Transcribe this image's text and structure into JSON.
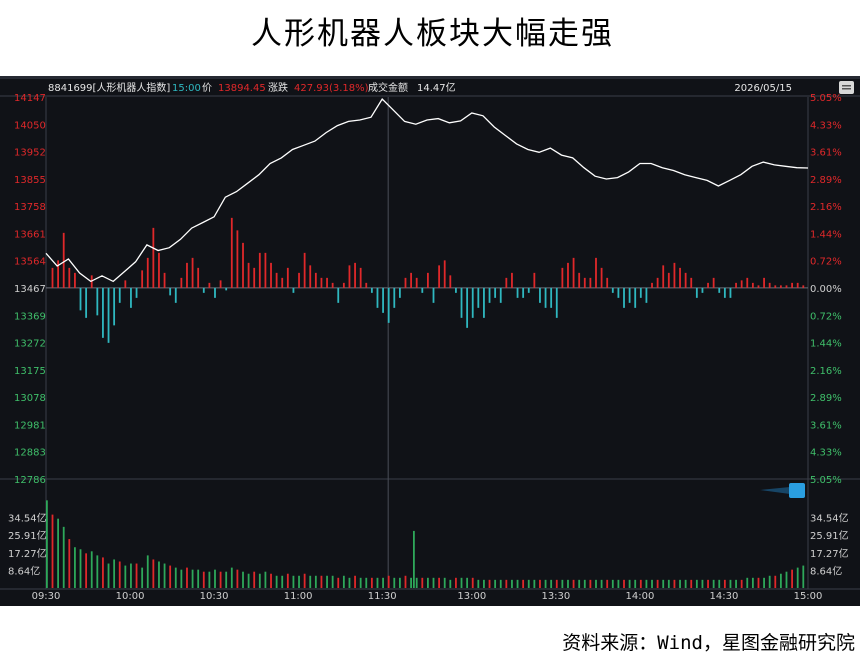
{
  "page": {
    "title": "人形机器人板块大幅走强",
    "source": "资料来源：Wind，星图金融研究院"
  },
  "info_bar": {
    "code": "8841699[人形机器人指数]",
    "time": "15:00",
    "price_label": "价",
    "price": "13894.45",
    "change_label": "涨跌",
    "change": "427.93(3.18%)",
    "turnover_label": "成交金额",
    "turnover": "14.47亿",
    "date": "2026/05/15"
  },
  "colors": {
    "up": "#e0282a",
    "down": "#2fb8c0",
    "price_line": "#ffffff",
    "panel_bg": "#101217",
    "axis_text_left": "#e0282a",
    "grid": "#2a2d35"
  },
  "chart_data": {
    "type": "line",
    "price_ticks": [
      "14147",
      "14050",
      "13952",
      "13855",
      "13758",
      "13661",
      "13564",
      "13467",
      "13369",
      "13272",
      "13175",
      "13078",
      "12981",
      "12883",
      "12786"
    ],
    "pct_ticks": [
      "5.05%",
      "4.33%",
      "3.61%",
      "2.89%",
      "2.16%",
      "1.44%",
      "0.72%",
      "0.00%",
      "0.72%",
      "1.44%",
      "2.16%",
      "2.89%",
      "3.61%",
      "4.33%",
      "5.05%"
    ],
    "volume_ticks": [
      "34.54亿",
      "25.91亿",
      "17.27亿",
      "8.64亿"
    ],
    "time_ticks": [
      "09:30",
      "10:00",
      "10:30",
      "11:00",
      "11:30",
      "13:00",
      "13:30",
      "14:00",
      "14:30",
      "15:00"
    ],
    "price_ylim": [
      12786,
      14147
    ],
    "pre_close": 13467,
    "volume_max": 43.17,
    "price": [
      [
        0,
        13590
      ],
      [
        4,
        13545
      ],
      [
        8,
        13570
      ],
      [
        12,
        13520
      ],
      [
        16,
        13490
      ],
      [
        20,
        13510
      ],
      [
        24,
        13490
      ],
      [
        28,
        13525
      ],
      [
        32,
        13560
      ],
      [
        36,
        13620
      ],
      [
        40,
        13600
      ],
      [
        44,
        13610
      ],
      [
        48,
        13640
      ],
      [
        52,
        13680
      ],
      [
        56,
        13700
      ],
      [
        60,
        13720
      ],
      [
        64,
        13790
      ],
      [
        68,
        13810
      ],
      [
        72,
        13840
      ],
      [
        76,
        13870
      ],
      [
        80,
        13910
      ],
      [
        84,
        13930
      ],
      [
        88,
        13960
      ],
      [
        92,
        13975
      ],
      [
        96,
        13990
      ],
      [
        100,
        14020
      ],
      [
        104,
        14045
      ],
      [
        108,
        14060
      ],
      [
        112,
        14065
      ],
      [
        116,
        14075
      ],
      [
        120,
        14140
      ],
      [
        124,
        14100
      ],
      [
        128,
        14060
      ],
      [
        132,
        14050
      ],
      [
        136,
        14065
      ],
      [
        140,
        14070
      ],
      [
        144,
        14055
      ],
      [
        148,
        14062
      ],
      [
        152,
        14090
      ],
      [
        156,
        14080
      ],
      [
        160,
        14040
      ],
      [
        164,
        14010
      ],
      [
        168,
        13980
      ],
      [
        172,
        13960
      ],
      [
        176,
        13950
      ],
      [
        180,
        13965
      ],
      [
        184,
        13940
      ],
      [
        188,
        13930
      ],
      [
        192,
        13895
      ],
      [
        196,
        13865
      ],
      [
        200,
        13855
      ],
      [
        204,
        13860
      ],
      [
        208,
        13880
      ],
      [
        212,
        13910
      ],
      [
        216,
        13910
      ],
      [
        220,
        13895
      ],
      [
        224,
        13885
      ],
      [
        228,
        13870
      ],
      [
        232,
        13860
      ],
      [
        236,
        13850
      ],
      [
        240,
        13830
      ],
      [
        244,
        13850
      ],
      [
        248,
        13870
      ],
      [
        252,
        13900
      ],
      [
        256,
        13915
      ],
      [
        260,
        13905
      ],
      [
        264,
        13900
      ],
      [
        268,
        13895
      ],
      [
        272,
        13894
      ]
    ],
    "bars": [
      [
        2,
        40
      ],
      [
        4,
        55
      ],
      [
        6,
        110
      ],
      [
        8,
        40
      ],
      [
        10,
        30
      ],
      [
        12,
        -45
      ],
      [
        14,
        -60
      ],
      [
        16,
        25
      ],
      [
        18,
        -55
      ],
      [
        20,
        -100
      ],
      [
        22,
        -110
      ],
      [
        24,
        -75
      ],
      [
        26,
        -30
      ],
      [
        28,
        15
      ],
      [
        30,
        -40
      ],
      [
        32,
        -20
      ],
      [
        34,
        35
      ],
      [
        36,
        60
      ],
      [
        38,
        120
      ],
      [
        40,
        70
      ],
      [
        42,
        30
      ],
      [
        44,
        -15
      ],
      [
        46,
        -30
      ],
      [
        48,
        20
      ],
      [
        50,
        50
      ],
      [
        52,
        60
      ],
      [
        54,
        40
      ],
      [
        56,
        -10
      ],
      [
        58,
        10
      ],
      [
        60,
        -20
      ],
      [
        62,
        15
      ],
      [
        64,
        -5
      ],
      [
        66,
        140
      ],
      [
        68,
        115
      ],
      [
        70,
        90
      ],
      [
        72,
        50
      ],
      [
        74,
        40
      ],
      [
        76,
        70
      ],
      [
        78,
        70
      ],
      [
        80,
        50
      ],
      [
        82,
        30
      ],
      [
        84,
        20
      ],
      [
        86,
        40
      ],
      [
        88,
        -10
      ],
      [
        90,
        30
      ],
      [
        92,
        70
      ],
      [
        94,
        45
      ],
      [
        96,
        30
      ],
      [
        98,
        20
      ],
      [
        100,
        20
      ],
      [
        102,
        10
      ],
      [
        104,
        -30
      ],
      [
        106,
        10
      ],
      [
        108,
        45
      ],
      [
        110,
        50
      ],
      [
        112,
        40
      ],
      [
        114,
        10
      ],
      [
        116,
        -10
      ],
      [
        118,
        -40
      ],
      [
        120,
        -50
      ],
      [
        122,
        -70
      ],
      [
        124,
        -40
      ],
      [
        126,
        -20
      ],
      [
        128,
        20
      ],
      [
        130,
        30
      ],
      [
        132,
        20
      ],
      [
        134,
        -10
      ],
      [
        136,
        30
      ],
      [
        138,
        -30
      ],
      [
        140,
        45
      ],
      [
        142,
        55
      ],
      [
        144,
        25
      ],
      [
        146,
        -10
      ],
      [
        148,
        -60
      ],
      [
        150,
        -80
      ],
      [
        152,
        -60
      ],
      [
        154,
        -40
      ],
      [
        156,
        -60
      ],
      [
        158,
        -30
      ],
      [
        160,
        -20
      ],
      [
        162,
        -30
      ],
      [
        164,
        20
      ],
      [
        166,
        30
      ],
      [
        168,
        -20
      ],
      [
        170,
        -20
      ],
      [
        172,
        -10
      ],
      [
        174,
        30
      ],
      [
        176,
        -30
      ],
      [
        178,
        -40
      ],
      [
        180,
        -40
      ],
      [
        182,
        -60
      ],
      [
        184,
        40
      ],
      [
        186,
        50
      ],
      [
        188,
        60
      ],
      [
        190,
        30
      ],
      [
        192,
        20
      ],
      [
        194,
        20
      ],
      [
        196,
        60
      ],
      [
        198,
        40
      ],
      [
        200,
        20
      ],
      [
        202,
        -10
      ],
      [
        204,
        -20
      ],
      [
        206,
        -40
      ],
      [
        208,
        -30
      ],
      [
        210,
        -40
      ],
      [
        212,
        -20
      ],
      [
        214,
        -30
      ],
      [
        216,
        10
      ],
      [
        218,
        20
      ],
      [
        220,
        45
      ],
      [
        222,
        30
      ],
      [
        224,
        50
      ],
      [
        226,
        40
      ],
      [
        228,
        30
      ],
      [
        230,
        20
      ],
      [
        232,
        -20
      ],
      [
        234,
        -10
      ],
      [
        236,
        10
      ],
      [
        238,
        20
      ],
      [
        240,
        -10
      ],
      [
        242,
        -20
      ],
      [
        244,
        -20
      ],
      [
        246,
        10
      ],
      [
        248,
        15
      ],
      [
        250,
        20
      ],
      [
        252,
        10
      ],
      [
        254,
        5
      ],
      [
        256,
        20
      ],
      [
        258,
        10
      ],
      [
        260,
        5
      ],
      [
        262,
        5
      ],
      [
        264,
        5
      ],
      [
        266,
        10
      ],
      [
        268,
        10
      ],
      [
        270,
        5
      ]
    ],
    "volume": [
      [
        0,
        43.0
      ],
      [
        2,
        36.0
      ],
      [
        4,
        34.0
      ],
      [
        6,
        30.0
      ],
      [
        8,
        24.0
      ],
      [
        10,
        20.0
      ],
      [
        12,
        19.0
      ],
      [
        14,
        17.0
      ],
      [
        16,
        18.0
      ],
      [
        18,
        16.0
      ],
      [
        20,
        15.0
      ],
      [
        22,
        12.0
      ],
      [
        24,
        14.0
      ],
      [
        26,
        13.0
      ],
      [
        28,
        11.0
      ],
      [
        30,
        12.0
      ],
      [
        32,
        12.0
      ],
      [
        34,
        10.0
      ],
      [
        36,
        16.0
      ],
      [
        38,
        14.0
      ],
      [
        40,
        13.0
      ],
      [
        42,
        12.0
      ],
      [
        44,
        11.0
      ],
      [
        46,
        10.0
      ],
      [
        48,
        9.0
      ],
      [
        50,
        10.0
      ],
      [
        52,
        9.0
      ],
      [
        54,
        9.0
      ],
      [
        56,
        8.0
      ],
      [
        58,
        8.0
      ],
      [
        60,
        9.0
      ],
      [
        62,
        8.0
      ],
      [
        64,
        8.0
      ],
      [
        66,
        10.0
      ],
      [
        68,
        9.0
      ],
      [
        70,
        8.0
      ],
      [
        72,
        7.0
      ],
      [
        74,
        8.0
      ],
      [
        76,
        7.0
      ],
      [
        78,
        8.0
      ],
      [
        80,
        7.0
      ],
      [
        82,
        6.0
      ],
      [
        84,
        6.0
      ],
      [
        86,
        7.0
      ],
      [
        88,
        6.0
      ],
      [
        90,
        6.0
      ],
      [
        92,
        7.0
      ],
      [
        94,
        6.0
      ],
      [
        96,
        6.0
      ],
      [
        98,
        6.0
      ],
      [
        100,
        6.0
      ],
      [
        102,
        6.0
      ],
      [
        104,
        5.0
      ],
      [
        106,
        6.0
      ],
      [
        108,
        5.0
      ],
      [
        110,
        6.0
      ],
      [
        112,
        5.0
      ],
      [
        114,
        5.0
      ],
      [
        116,
        5.0
      ],
      [
        118,
        5.0
      ],
      [
        120,
        5.0
      ],
      [
        122,
        6.0
      ],
      [
        124,
        5.0
      ],
      [
        126,
        5.0
      ],
      [
        128,
        6.0
      ],
      [
        130,
        5.0
      ],
      [
        132,
        5.0
      ],
      [
        134,
        5.0
      ],
      [
        136,
        5.0
      ],
      [
        138,
        5.0
      ],
      [
        140,
        5.0
      ],
      [
        142,
        5.0
      ],
      [
        144,
        4.0
      ],
      [
        146,
        5.0
      ],
      [
        148,
        5.0
      ],
      [
        150,
        5.0
      ],
      [
        152,
        5.0
      ],
      [
        154,
        4.0
      ],
      [
        156,
        4.0
      ],
      [
        158,
        4.0
      ],
      [
        160,
        4.0
      ],
      [
        162,
        4.0
      ],
      [
        164,
        4.0
      ],
      [
        166,
        4.0
      ],
      [
        168,
        4.0
      ],
      [
        170,
        4.0
      ],
      [
        172,
        4.0
      ],
      [
        174,
        4.0
      ],
      [
        176,
        4.0
      ],
      [
        178,
        4.0
      ],
      [
        180,
        4.0
      ],
      [
        182,
        4.0
      ],
      [
        184,
        4.0
      ],
      [
        186,
        4.0
      ],
      [
        188,
        4.0
      ],
      [
        190,
        4.0
      ],
      [
        192,
        4.0
      ],
      [
        194,
        4.0
      ],
      [
        196,
        4.0
      ],
      [
        198,
        4.0
      ],
      [
        200,
        4.0
      ],
      [
        202,
        4.0
      ],
      [
        204,
        4.0
      ],
      [
        206,
        4.0
      ],
      [
        208,
        4.0
      ],
      [
        210,
        4.0
      ],
      [
        212,
        4.0
      ],
      [
        214,
        4.0
      ],
      [
        216,
        4.0
      ],
      [
        218,
        4.0
      ],
      [
        220,
        4.0
      ],
      [
        222,
        4.0
      ],
      [
        224,
        4.0
      ],
      [
        226,
        4.0
      ],
      [
        228,
        4.0
      ],
      [
        230,
        4.0
      ],
      [
        232,
        4.0
      ],
      [
        234,
        4.0
      ],
      [
        236,
        4.0
      ],
      [
        238,
        4.0
      ],
      [
        240,
        4.0
      ],
      [
        242,
        4.0
      ],
      [
        244,
        4.0
      ],
      [
        246,
        4.0
      ],
      [
        248,
        4.0
      ],
      [
        250,
        5.0
      ],
      [
        252,
        5.0
      ],
      [
        254,
        5.0
      ],
      [
        256,
        5.0
      ],
      [
        258,
        6.0
      ],
      [
        260,
        6.0
      ],
      [
        262,
        7.0
      ],
      [
        264,
        8.0
      ],
      [
        266,
        9.0
      ],
      [
        268,
        10.0
      ],
      [
        270,
        11.0
      ]
    ],
    "volume_spike": [
      [
        131,
        28.0
      ]
    ],
    "session_split_minute": 120,
    "total_minutes": 272,
    "grid": true
  }
}
